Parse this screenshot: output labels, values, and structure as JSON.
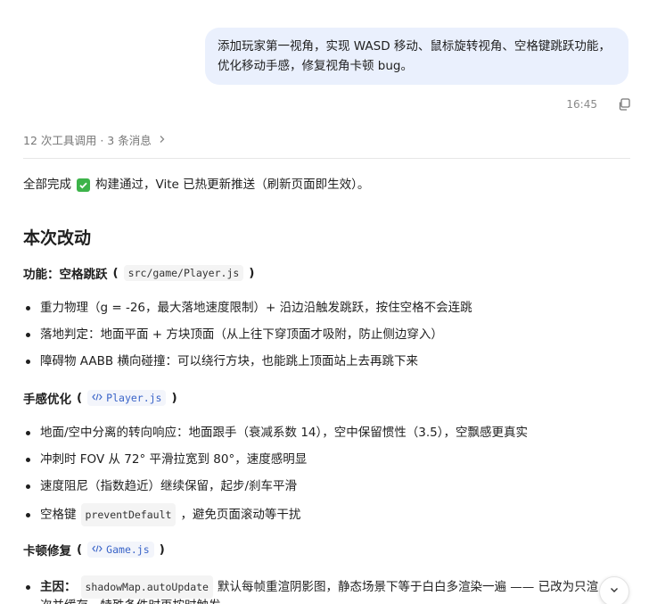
{
  "user_message": {
    "text": "添加玩家第一视角，实现 WASD 移动、鼠标旋转视角、空格键跳跃功能，优化移动手感，修复视角卡顿 bug。",
    "time": "16:45"
  },
  "tool_summary": {
    "text": "12 次工具调用 · 3 条消息"
  },
  "response": {
    "status_prefix": "全部完成",
    "status_suffix": "构建通过，Vite 已热更新推送（刷新页面即生效）。",
    "section_title": "本次改动",
    "features": {
      "heading": "功能：空格跳跃",
      "file": "src/game/Player.js",
      "items": [
        "重力物理（g = -26，最大落地速度限制）+ 沿边沿触发跳跃，按住空格不会连跳",
        "落地判定：地面平面 + 方块顶面（从上往下穿顶面才吸附，防止侧边穿入）",
        "障碍物 AABB 横向碰撞：可以绕行方块，也能跳上顶面站上去再跳下来"
      ]
    },
    "feel": {
      "heading": "手感优化",
      "file": "Player.js",
      "items": [
        "地面/空中分离的转向响应：地面跟手（衰减系数 14），空中保留惯性（3.5），空飘感更真实",
        "冲刺时 FOV 从 72° 平滑拉宽到 80°，速度感明显",
        "速度阻尼（指数趋近）继续保留，起步/刹车平滑"
      ],
      "space_item_prefix": "空格键",
      "space_item_code": "preventDefault",
      "space_item_suffix": "，避免页面滚动等干扰"
    },
    "fix": {
      "heading": "卡顿修复",
      "file": "Game.js",
      "main_label": "主因：",
      "main_code": "shadowMap.autoUpdate",
      "main_text": "默认每帧重渲阴影图，静态场景下等于白白多渲染一遍 —— 已改为只渲",
      "next_line": "次并缓存，特殊条件时再按时触发"
    }
  },
  "icons": {
    "check": "check-icon",
    "copy": "copy-icon",
    "chevron": "chevron-right-icon",
    "scroll_down": "chevron-down-icon",
    "code": "code-icon"
  },
  "colors": {
    "bubble": "#eaf0fd",
    "check": "#3db34a",
    "link": "#3a64c8"
  }
}
